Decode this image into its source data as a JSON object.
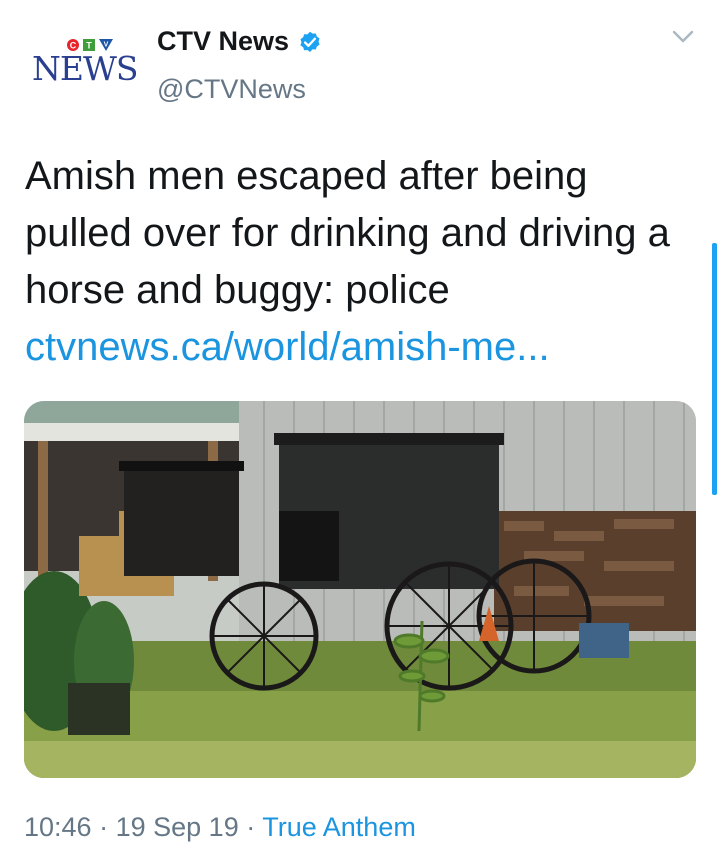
{
  "author": {
    "logo_top": "CTV",
    "logo_bottom": "NEWS",
    "display_name": "CTV News",
    "handle": "@CTVNews",
    "verified": true
  },
  "tweet": {
    "text": "Amish men escaped after being pulled over for drinking and driving a horse and buggy: police",
    "link": "ctvnews.ca/world/amish-me..."
  },
  "media": {
    "description_icon": "photo"
  },
  "footer": {
    "time": "10:46",
    "date": "19 Sep 19",
    "source": "True Anthem",
    "separator": "·"
  },
  "icons": {
    "verified": "verified-badge-icon",
    "caret": "chevron-down-icon"
  },
  "colors": {
    "link": "#1b95e0",
    "secondary_text": "#657786",
    "verified": "#1da1f2",
    "logo_blue": "#2a3f8f"
  }
}
